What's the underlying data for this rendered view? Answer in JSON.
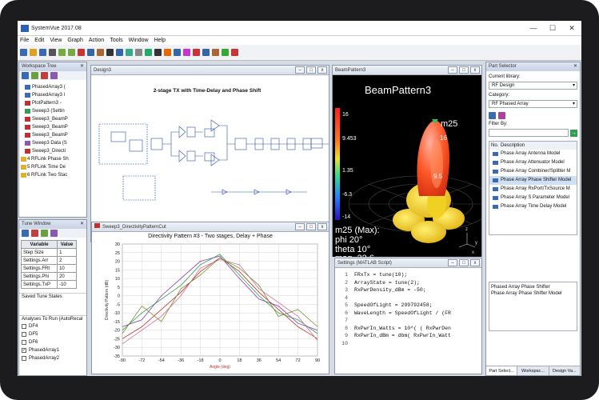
{
  "app": {
    "title": "SystemVue 2017.08"
  },
  "window_controls": {
    "minimize": "—",
    "maximize": "☐",
    "close": "✕"
  },
  "menu": [
    "File",
    "Edit",
    "View",
    "Graph",
    "Action",
    "Tools",
    "Window",
    "Help"
  ],
  "toolbar_icons": [
    "new-icon",
    "open-icon",
    "save-icon",
    "print-icon",
    "undo-icon",
    "redo-icon",
    "cut-icon",
    "copy-icon",
    "paste-icon",
    "pointer-icon",
    "select-icon",
    "zoom-icon",
    "grid-icon",
    "wire-icon",
    "text-icon",
    "color-icon",
    "align-icon",
    "marker-icon",
    "plot-icon",
    "chart-icon",
    "dataset-icon",
    "run-icon",
    "stop-icon"
  ],
  "workspace_tree": {
    "title": "Workspace Tree",
    "items": [
      {
        "label": "PhasedArray3 (",
        "icon": "schematic"
      },
      {
        "label": "PhasedArray3 l",
        "icon": "schematic"
      },
      {
        "label": "PlotPattern3 -",
        "icon": "graph"
      },
      {
        "label": "Sweep3 (Settin",
        "icon": "sweep"
      },
      {
        "label": "Sweep3_BeamP",
        "icon": "graph"
      },
      {
        "label": "Sweep3_BeamP",
        "icon": "graph"
      },
      {
        "label": "Sweep3_BeamP",
        "icon": "graph"
      },
      {
        "label": "Sweep3 Data (S",
        "icon": "data"
      },
      {
        "label": "Sweep3_Directi",
        "icon": "graph"
      },
      {
        "label": "4 RFLink Phase Sh",
        "icon": "folder"
      },
      {
        "label": "5 RFLink Time De",
        "icon": "folder"
      },
      {
        "label": "6 RFLink Two Stac",
        "icon": "folder"
      }
    ]
  },
  "tune_window": {
    "title": "Tune Window",
    "headers": [
      "Variable",
      "Value"
    ],
    "rows": [
      [
        "Step Size",
        "1"
      ],
      [
        "Settings.Arr",
        "2"
      ],
      [
        "Settings.FRt",
        "10"
      ],
      [
        "Settings.Phi",
        "20"
      ],
      [
        "Settings.TxP",
        "-10"
      ]
    ],
    "saved_label": "Saved Tune States",
    "analyses_label": "Analyses To Run (AutoRecal",
    "analyses": [
      {
        "label": "DF4",
        "checked": false
      },
      {
        "label": "DF5",
        "checked": false
      },
      {
        "label": "DF6",
        "checked": false
      },
      {
        "label": "PhasedArray1",
        "checked": true
      },
      {
        "label": "PhasedArray2",
        "checked": false
      }
    ]
  },
  "design_window": {
    "title": "Design3",
    "heading": "2-stage TX with Time-Delay and Phase Shift"
  },
  "beam_window": {
    "title": "BeamPattern3",
    "plot_title": "BeamPattern3",
    "marker": "m25",
    "scale_values": [
      "16",
      "9.453",
      "1.35",
      "-6.3",
      "-14"
    ],
    "marker_values": [
      "9.5",
      "16"
    ],
    "readout": [
      "m25 (Max):",
      "phi 20°",
      "theta 10°",
      "mag. 22.6"
    ],
    "axis_labels": [
      "z",
      "y",
      "x"
    ]
  },
  "directivity_window": {
    "title": "Sweep3_DirectivityPatternCut",
    "plot_title": "Directivity Pattern #3 - Two stages, Delay + Phase",
    "ylabel": "Directivity Pattern (dB)",
    "xlabel": "Angle (deg)"
  },
  "chart_data": {
    "type": "line",
    "title": "Directivity Pattern #3 - Two stages, Delay + Phase",
    "xlim": [
      -90,
      90
    ],
    "ylim": [
      -35,
      30
    ],
    "x_ticks": [
      "-90",
      "-72",
      "-54",
      "-36",
      "-18",
      "0",
      "18",
      "36",
      "54",
      "72",
      "90"
    ],
    "y_ticks": [
      "30",
      "25",
      "20",
      "15",
      "10",
      "5",
      "0",
      "-5",
      "-10",
      "-15",
      "-20",
      "-25",
      "-30",
      "-35"
    ],
    "series": [
      {
        "color": "#c03030",
        "values": [
          [
            -90,
            -25
          ],
          [
            -72,
            -18
          ],
          [
            -54,
            -8
          ],
          [
            -36,
            2
          ],
          [
            -18,
            14
          ],
          [
            0,
            22
          ],
          [
            18,
            14
          ],
          [
            36,
            2
          ],
          [
            54,
            -8
          ],
          [
            72,
            -18
          ],
          [
            90,
            -25
          ]
        ]
      },
      {
        "color": "#30a050",
        "values": [
          [
            -90,
            -20
          ],
          [
            -72,
            -10
          ],
          [
            -54,
            -2
          ],
          [
            -36,
            6
          ],
          [
            -18,
            18
          ],
          [
            0,
            24
          ],
          [
            18,
            12
          ],
          [
            36,
            0
          ],
          [
            54,
            -10
          ],
          [
            72,
            -14
          ],
          [
            90,
            -22
          ]
        ]
      },
      {
        "color": "#8a40b0",
        "values": [
          [
            -90,
            -18
          ],
          [
            -72,
            -14
          ],
          [
            -54,
            0
          ],
          [
            -36,
            10
          ],
          [
            -18,
            20
          ],
          [
            0,
            23
          ],
          [
            18,
            10
          ],
          [
            36,
            -2
          ],
          [
            54,
            -6
          ],
          [
            72,
            -16
          ],
          [
            90,
            -20
          ]
        ]
      },
      {
        "color": "#d070a0",
        "values": [
          [
            -90,
            -28
          ],
          [
            -72,
            -20
          ],
          [
            -54,
            -12
          ],
          [
            -36,
            0
          ],
          [
            -18,
            16
          ],
          [
            0,
            21
          ],
          [
            18,
            18
          ],
          [
            36,
            4
          ],
          [
            54,
            -4
          ],
          [
            72,
            -12
          ],
          [
            90,
            -26
          ]
        ]
      },
      {
        "color": "#7c8f2a",
        "values": [
          [
            -90,
            -22
          ],
          [
            -72,
            -6
          ],
          [
            -54,
            -15
          ],
          [
            -36,
            4
          ],
          [
            -18,
            12
          ],
          [
            0,
            22
          ],
          [
            18,
            16
          ],
          [
            36,
            6
          ],
          [
            54,
            -12
          ],
          [
            72,
            -8
          ],
          [
            90,
            -18
          ]
        ]
      }
    ],
    "grid": true
  },
  "settings_window": {
    "title": "Settings (MATLAB Script)",
    "lines": [
      {
        "n": "1",
        "code": "FRxTx = tune(10);"
      },
      {
        "n": "2",
        "code": "ArrayState = tune(2);"
      },
      {
        "n": "3",
        "code": "RxPwrDensity_dBm = -50;"
      },
      {
        "n": "4",
        "code": ""
      },
      {
        "n": "5",
        "code": "SpeedOfLight = 299792458;"
      },
      {
        "n": "6",
        "code": "WaveLength = SpeedOfLight / (FR"
      },
      {
        "n": "7",
        "code": ""
      },
      {
        "n": "8",
        "code": "RxPwrIn_Watts = 10^( ( RxPwrDen"
      },
      {
        "n": "9",
        "code": "RxPwrIn_dBm = dbm( RxPwrIn_Watt"
      },
      {
        "n": "10",
        "code": ""
      }
    ]
  },
  "part_selector": {
    "title": "Part Selector",
    "current_library_label": "Current library:",
    "current_library": "RF Design",
    "category_label": "Category:",
    "category": "RF Phased Array",
    "filter_label": "Filter By:",
    "col_no": "No.",
    "col_desc": "Description",
    "parts": [
      "Phase Array Antenna Model",
      "Phase Array Attenuator Model",
      "Phase Array Combiner/Splitter M",
      "Phase Array Phase Shifter Model",
      "Phase Array RxPort/TxSource M",
      "Phase Array S Parameter Model",
      "Phase Array Time Delay Model"
    ],
    "description_title": "Phased Array Phase Shifter",
    "description_text": "Phase Array Phase Shifter Model",
    "tabs": [
      "Part Select...",
      "Workspac...",
      "Design Va..."
    ]
  }
}
